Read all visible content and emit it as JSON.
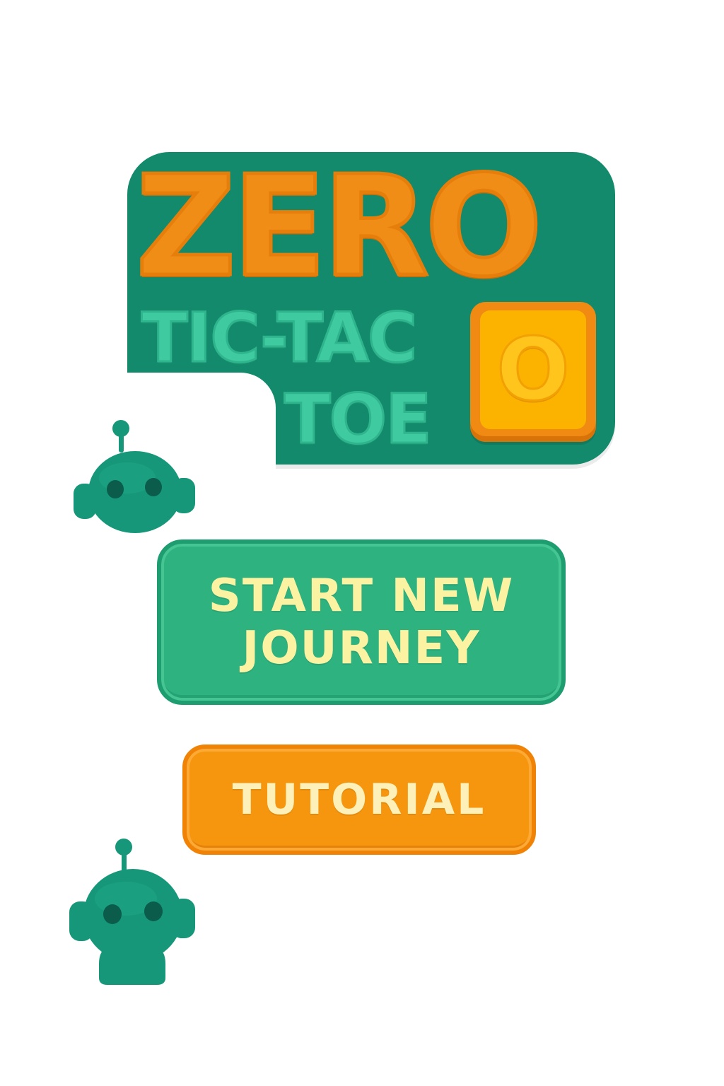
{
  "logo": {
    "line1": "ZERO",
    "line2": "TIC-TAC",
    "line3": "TOE",
    "tile_letter": "O"
  },
  "menu": {
    "start_label": "START NEW JOURNEY",
    "tutorial_label": "TUTORIAL"
  },
  "mascots": [
    "robot-icon",
    "robot-icon"
  ],
  "colors": {
    "background": "#ffffff",
    "logo_badge": "#138a6b",
    "logo_orange": "#f08d17",
    "logo_teal": "#3fcaa0",
    "tile_yellow": "#fbb300",
    "start_button": "#2eb280",
    "start_text": "#fbf2a2",
    "tutorial_button": "#f6960f",
    "tutorial_text": "#fdf0b9",
    "robot": "#16977a"
  }
}
